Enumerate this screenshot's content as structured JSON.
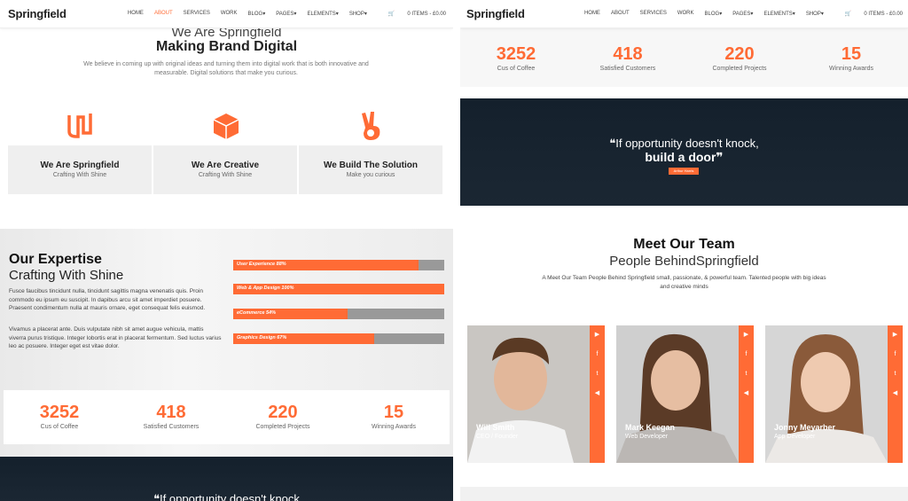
{
  "nav": {
    "logo": "Springfield",
    "items": [
      "HOME",
      "ABOUT",
      "SERVICES",
      "WORK",
      "BLOG▾",
      "PAGES▾",
      "ELEMENTS▾",
      "SHOP▾"
    ],
    "active_index": 1,
    "cart": "0 ITEMS - £0.00"
  },
  "intro": {
    "title_a": "We Are Springfield",
    "title_b": "Making Brand Digital",
    "text": "We believe in coming up with original ideas and turning them into digital work that is both innovative and measurable. Digital solutions that make you curious."
  },
  "features": [
    {
      "icon": "wave-icon",
      "title": "We Are Springfield",
      "sub": "Crafting With Shine"
    },
    {
      "icon": "cube-icon",
      "title": "We Are Creative",
      "sub": "Crafting With Shine"
    },
    {
      "icon": "peace-hand-icon",
      "title": "We Build The Solution",
      "sub": "Make you curious"
    }
  ],
  "expertise": {
    "title": "Our Expertise",
    "sub": "Crafting With Shine",
    "p1": "Fusce faucibus tincidunt nulla, tincidunt sagittis magna venenatis quis. Proin commodo eu ipsum eu suscipit. In dapibus arcu sit amet imperdiet posuere. Praesent condimentum nulla at mauris ornare, eget consequat felis euismod.",
    "p2": "Vivamus a placerat ante. Duis vulputate nibh sit amet augue vehicula, mattis viverra purus tristique. Integer lobortis erat in placerat fermentum. Sed luctus varius leo ac posuere. Integer eget est vitae dolor.",
    "skills": [
      {
        "label": "User Experience   88%",
        "value": 0.88
      },
      {
        "label": "Web & App Design   100%",
        "value": 1.0
      },
      {
        "label": "eCommerce   54%",
        "value": 0.54
      },
      {
        "label": "Graphics Design   67%",
        "value": 0.67
      }
    ]
  },
  "stats": [
    {
      "n": "3252",
      "l": "Cus of Coffee"
    },
    {
      "n": "418",
      "l": "Satisfied Customers"
    },
    {
      "n": "220",
      "l": "Completed Projects"
    },
    {
      "n": "15",
      "l": "Winning Awards"
    }
  ],
  "quote": {
    "line1": "❝If opportunity doesn't knock,",
    "line2": "build a door❞",
    "button": "Arthur Harris",
    "left_partial": "❝If opportunity doesn't knock"
  },
  "team": {
    "title": "Meet Our Team",
    "sub": "People BehindSpringfield",
    "text": "A Meet Our Team People Behind Springfield small, passionate, & powerful team. Talented people with big ideas and creative minds",
    "members": [
      {
        "name": "Will Smith",
        "role": "CEO / Founder"
      },
      {
        "name": "Mark Keegan",
        "role": "Web Developer"
      },
      {
        "name": "Jonny Meyarber",
        "role": "App Developer"
      }
    ],
    "social_icons": [
      "youtube-icon",
      "facebook-icon",
      "twitter-icon",
      "megaphone-icon"
    ]
  },
  "colors": {
    "accent": "#ff6b35",
    "dark": "#17222e"
  }
}
